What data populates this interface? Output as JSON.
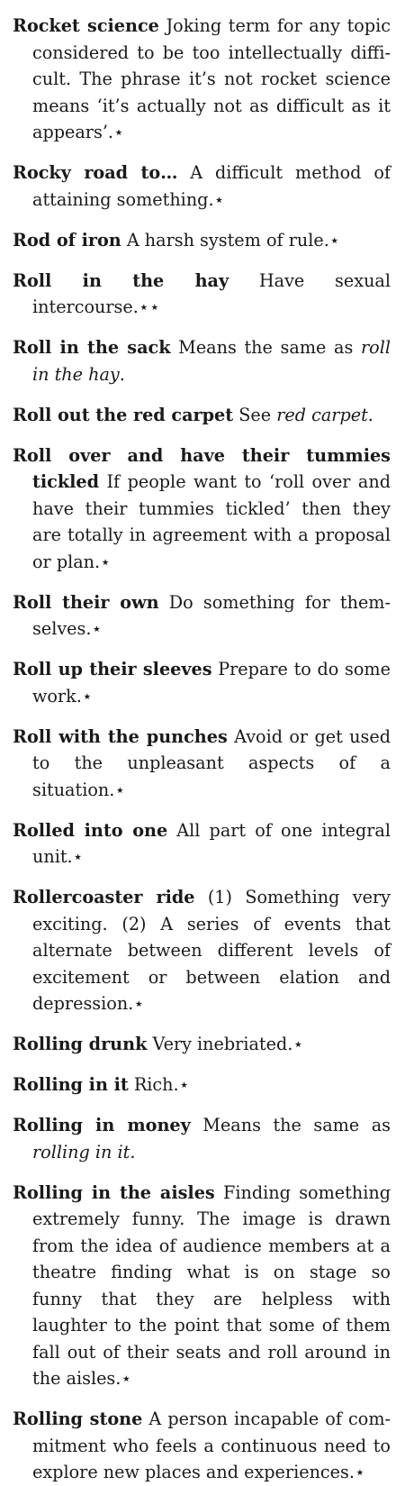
{
  "entries": [
    {
      "term": "Rocket science",
      "definition": [
        {
          "text": " Joking term for any topic considered to be too intellectually diffi­cult. The phrase it’s not rocket science means ‘it’s actually not as difficult as it appears’.⋆"
        }
      ]
    },
    {
      "term": "Rocky road to…",
      "definition": [
        {
          "text": " A difficult method of attaining something.⋆"
        }
      ]
    },
    {
      "term": "Rod of iron",
      "definition": [
        {
          "text": " A harsh system of rule.⋆"
        }
      ]
    },
    {
      "term": "Roll in the hay",
      "definition": [
        {
          "text": " Have sexual intercourse.⋆⋆"
        }
      ]
    },
    {
      "term": "Roll in the sack",
      "definition": [
        {
          "text": " Means the same as "
        },
        {
          "text": "roll in the hay",
          "italic": true
        },
        {
          "text": "."
        }
      ]
    },
    {
      "term": "Roll out the red carpet",
      "definition": [
        {
          "text": " See "
        },
        {
          "text": "red carpet.",
          "italic": true
        }
      ]
    },
    {
      "term": "Roll over and have their tummies tickled",
      "definition": [
        {
          "text": " If people want to ‘roll over and have their tummies tickled’ then they are totally in agreement with a proposal or plan.⋆"
        }
      ]
    },
    {
      "term": "Roll their own",
      "definition": [
        {
          "text": " Do something for them­selves.⋆"
        }
      ]
    },
    {
      "term": "Roll up their sleeves",
      "definition": [
        {
          "text": " Prepare to do some work.⋆"
        }
      ]
    },
    {
      "term": "Roll with the punches",
      "definition": [
        {
          "text": " Avoid or get used to the unpleasant aspects of a situation.⋆"
        }
      ]
    },
    {
      "term": "Rolled into one",
      "definition": [
        {
          "text": " All part of one integral unit.⋆"
        }
      ]
    },
    {
      "term": "Rollercoaster ride",
      "definition": [
        {
          "text": " (1) Something very exciting. (2) A series of events that alter­nate between different levels of excite­ment or between elation and depression.⋆"
        }
      ]
    },
    {
      "term": "Rolling drunk",
      "definition": [
        {
          "text": " Very inebriated.⋆"
        }
      ]
    },
    {
      "term": "Rolling in it",
      "definition": [
        {
          "text": " Rich.⋆"
        }
      ]
    },
    {
      "term": "Rolling in money",
      "definition": [
        {
          "text": " Means the same as "
        },
        {
          "text": "rolling in it.",
          "italic": true
        }
      ]
    },
    {
      "term": "Rolling in the aisles",
      "definition": [
        {
          "text": " Finding something extremely funny. The image is drawn from the idea of audience members at a theatre finding what is on stage so funny that they are helpless with laughter to the point that some of them fall out of their seats and roll around in the aisles.⋆"
        }
      ]
    },
    {
      "term": "Rolling stone",
      "definition": [
        {
          "text": " A person incapable of com­mitment who feels a continuous need to explore new places and experiences.⋆"
        }
      ]
    }
  ]
}
